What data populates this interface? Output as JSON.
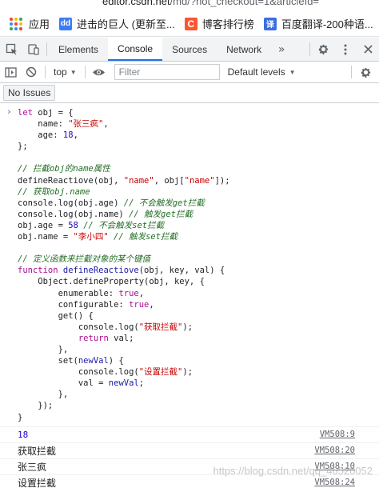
{
  "browser": {
    "url_host": "editor.csdn.net",
    "url_rest": "/md/?not_checkout=1&articleId="
  },
  "bookmarks": {
    "apps_label": "应用",
    "items": [
      {
        "icon": "dd-icon",
        "label": "进击的巨人 (更新至..."
      },
      {
        "icon": "csdn-c-icon",
        "label": "博客排行榜"
      },
      {
        "icon": "translate-icon",
        "label": "百度翻译-200种语..."
      }
    ]
  },
  "devtools": {
    "tabs": [
      "Elements",
      "Console",
      "Sources",
      "Network"
    ],
    "active_tab": "Console"
  },
  "toolbar": {
    "context": "top",
    "filter_placeholder": "Filter",
    "levels": "Default levels"
  },
  "issues": {
    "label": "No Issues"
  },
  "code": {
    "l1_kw": "let",
    "l1_rest": " obj = {",
    "l2_key": "    name: ",
    "l2_str": "\"张三疯\"",
    "l2_end": ",",
    "l3_key": "    age: ",
    "l3_num": "18",
    "l3_end": ",",
    "l4": "};",
    "c1": "// 拦截obj的name属性",
    "l6_pre": "defineReactiove(obj, ",
    "l6_s1": "\"name\"",
    "l6_mid": ", obj[",
    "l6_s2": "\"name\"",
    "l6_end": "]);",
    "c2": "// 获取obj.name",
    "l8_pre": "console.log(obj.age) ",
    "l8_cm": "// 不会触发get拦截",
    "l9_pre": "console.log(obj.name) ",
    "l9_cm": "// 触发get拦截",
    "l10_pre": "obj.age = ",
    "l10_num": "58",
    "l10_cm": " // 不会触发set拦截",
    "l11_pre": "obj.name = ",
    "l11_str": "\"李小四\"",
    "l11_cm": " // 触发set拦截",
    "c3": "// 定义函数来拦截对象的某个键值",
    "l14_kw": "function",
    "l14_fn": " defineReactiove",
    "l14_rest": "(obj, key, val) {",
    "l15": "    Object.defineProperty(obj, key, {",
    "l16_pre": "        enumerable: ",
    "l16_kw": "true",
    "l16_end": ",",
    "l17_pre": "        configurable: ",
    "l17_kw": "true",
    "l17_end": ",",
    "l18": "        get() {",
    "l19_pre": "            console.log(",
    "l19_str": "\"获取拦截\"",
    "l19_end": ");",
    "l20_kw": "            return",
    "l20_end": " val;",
    "l21": "        },",
    "l22_pre": "        set(",
    "l22_arg": "newVal",
    "l22_end": ") {",
    "l23_pre": "            console.log(",
    "l23_str": "\"设置拦截\"",
    "l23_end": ");",
    "l24_pre": "            val = ",
    "l24_arg": "newVal",
    "l24_end": ";",
    "l25": "        },",
    "l26": "    });",
    "l27": "}"
  },
  "logs": [
    {
      "value": "18",
      "source": "VM508:9"
    },
    {
      "value": "获取拦截",
      "source": "VM508:20"
    },
    {
      "value": "张三疯",
      "source": "VM508:10"
    },
    {
      "value": "设置拦截",
      "source": "VM508:24"
    }
  ],
  "watermark": "https://blog.csdn.net/qq_46520052"
}
